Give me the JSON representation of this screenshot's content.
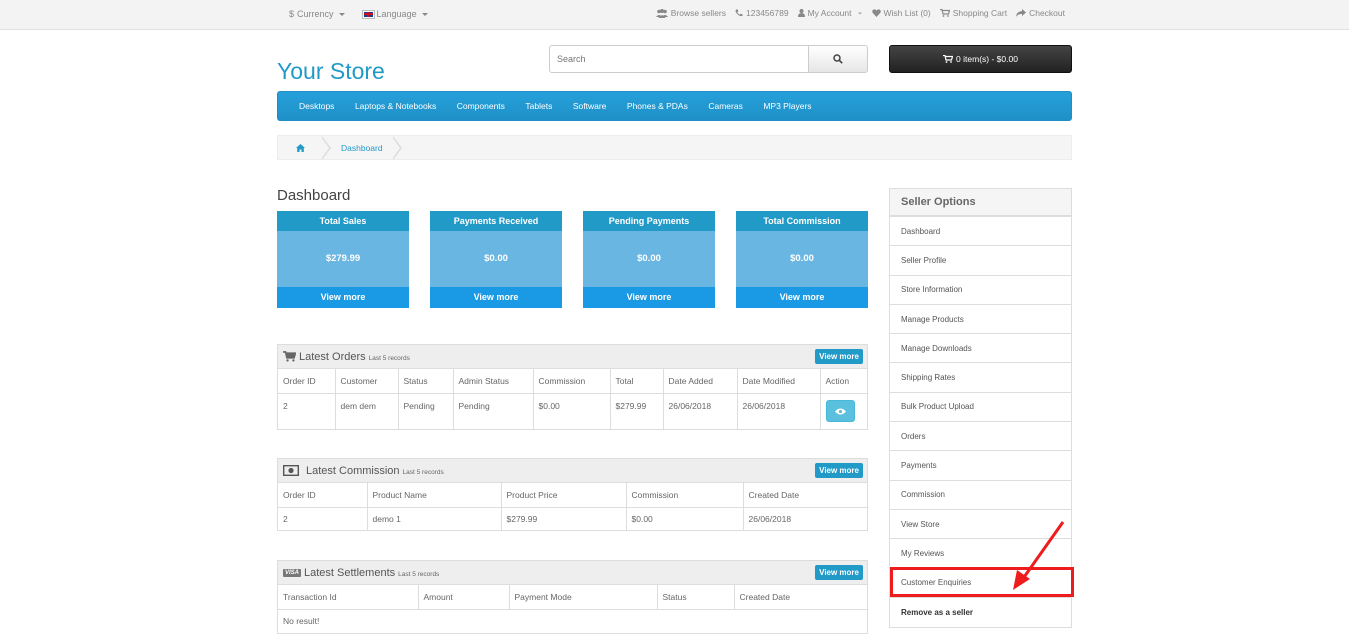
{
  "topbar": {
    "currency": "Currency",
    "language": "Language",
    "browse_sellers": "Browse sellers",
    "phone": "123456789",
    "my_account": "My Account",
    "wish_list": "Wish List (0)",
    "shopping_cart": "Shopping Cart",
    "checkout": "Checkout"
  },
  "header": {
    "logo": "Your Store",
    "search_placeholder": "Search",
    "cart_label": "0 item(s) - $0.00"
  },
  "menu": [
    "Desktops",
    "Laptops & Notebooks",
    "Components",
    "Tablets",
    "Software",
    "Phones & PDAs",
    "Cameras",
    "MP3 Players"
  ],
  "breadcrumb": {
    "current": "Dashboard"
  },
  "dashboard": {
    "title": "Dashboard",
    "stats": [
      {
        "label": "Total Sales",
        "value": "$279.99",
        "link": "View more"
      },
      {
        "label": "Payments Received",
        "value": "$0.00",
        "link": "View more"
      },
      {
        "label": "Pending Payments",
        "value": "$0.00",
        "link": "View more"
      },
      {
        "label": "Total Commission",
        "value": "$0.00",
        "link": "View more"
      }
    ]
  },
  "orders": {
    "title": "Latest Orders",
    "subtitle": "Last 5 records",
    "view_more": "View more",
    "headers": [
      "Order ID",
      "Customer",
      "Status",
      "Admin Status",
      "Commission",
      "Total",
      "Date Added",
      "Date Modified",
      "Action"
    ],
    "rows": [
      [
        "2",
        "dem dem",
        "Pending",
        "Pending",
        "$0.00",
        "$279.99",
        "26/06/2018",
        "26/06/2018"
      ]
    ]
  },
  "commission": {
    "title": "Latest Commission",
    "subtitle": "Last 5 records",
    "view_more": "View more",
    "headers": [
      "Order ID",
      "Product Name",
      "Product Price",
      "Commission",
      "Created Date"
    ],
    "rows": [
      [
        "2",
        "demo 1",
        "$279.99",
        "$0.00",
        "26/06/2018"
      ]
    ]
  },
  "settlements": {
    "title": "Latest Settlements",
    "subtitle": "Last 5 records",
    "view_more": "View more",
    "headers": [
      "Transaction Id",
      "Amount",
      "Payment Mode",
      "Status",
      "Created Date"
    ],
    "empty": "No result!",
    "visa_text": "VISA"
  },
  "sidebar": {
    "title": "Seller Options",
    "items": [
      "Dashboard",
      "Seller Profile",
      "Store Information",
      "Manage Products",
      "Manage Downloads",
      "Shipping Rates",
      "Bulk Product Upload",
      "Orders",
      "Payments",
      "Commission",
      "View Store",
      "My Reviews",
      "Customer Enquiries",
      "Remove as a seller"
    ]
  },
  "colors": {
    "accent": "#229ac8",
    "highlight": "#ee1c1c"
  }
}
